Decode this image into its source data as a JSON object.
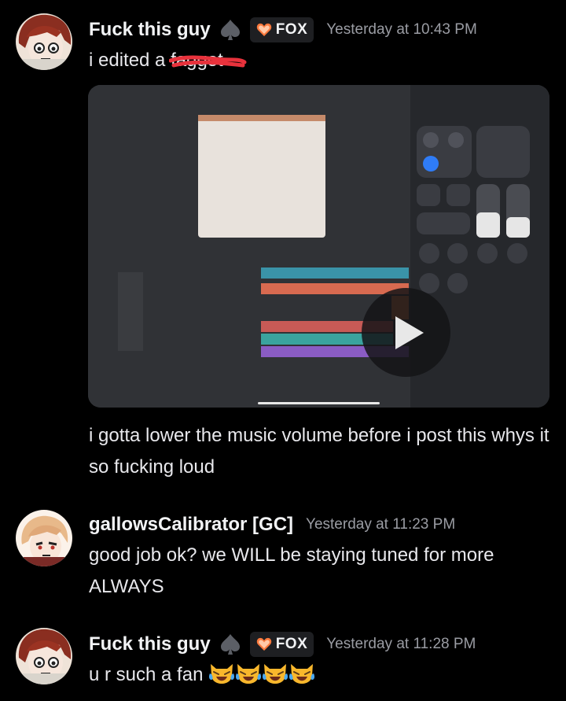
{
  "messages": [
    {
      "username": "Fuck this guy",
      "tag": "FOX",
      "timestamp": "Yesterday at 10:43 PM",
      "text_before": "i edited a ",
      "text_struck": "faggot",
      "video": {
        "media": "screen-recording",
        "icon": "play-icon"
      },
      "follow_up": "i gotta lower the music volume before i post this whys it so fucking loud"
    },
    {
      "username": "gallowsCalibrator [GC]",
      "timestamp": "Yesterday at 11:23 PM",
      "text": "good job ok? we WILL be staying tuned for more ALWAYS"
    },
    {
      "username": "Fuck this guy",
      "tag": "FOX",
      "timestamp": "Yesterday at 11:28 PM",
      "text": "u r such a fan",
      "emoji": [
        "joy-cat-emoji",
        "joy-cat-emoji",
        "joy-cat-emoji",
        "joy-cat-emoji"
      ]
    }
  ],
  "colors": {
    "background": "#000000",
    "username": "#f2f3f5",
    "timestamp": "#9a9ca3",
    "tag_bg": "#1e1f22",
    "strike_red": "#e8323c",
    "heart": "#ff7a3d"
  }
}
